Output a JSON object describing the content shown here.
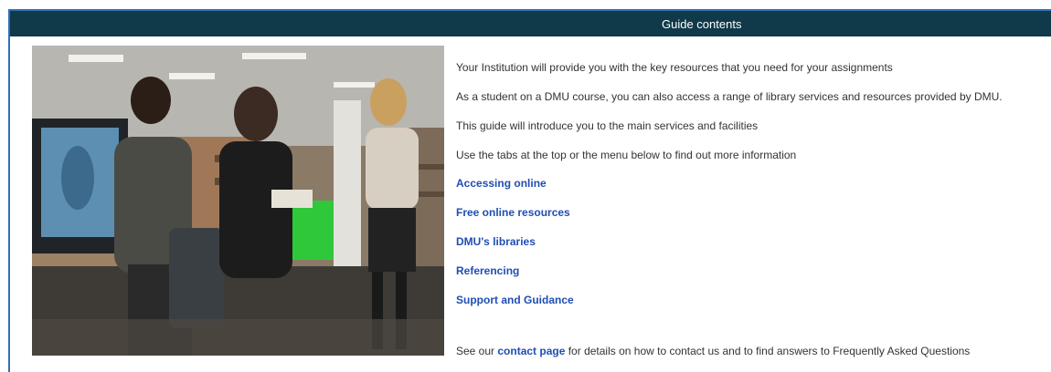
{
  "header": {
    "title": "Guide contents"
  },
  "intro": {
    "paragraphs": [
      "Your Institution will provide you with the key resources that you need for your assignments",
      "As a student on a DMU course, you can also access a range of library services and resources provided by DMU.",
      "This guide will introduce you to the main services and facilities",
      "Use the tabs at the top or the menu below to find out more information"
    ]
  },
  "menu": {
    "links": [
      "Accessing online",
      "Free online resources",
      "DMU's libraries",
      "Referencing",
      "Support and Guidance"
    ]
  },
  "footer": {
    "prefix": "See our ",
    "link": "contact page",
    "suffix": " for details on how to contact us and to find answers to Frequently Asked Questions"
  },
  "colors": {
    "header_bg": "#103a4a",
    "link": "#1f4eb4",
    "panel_border": "#2f6fb8"
  }
}
